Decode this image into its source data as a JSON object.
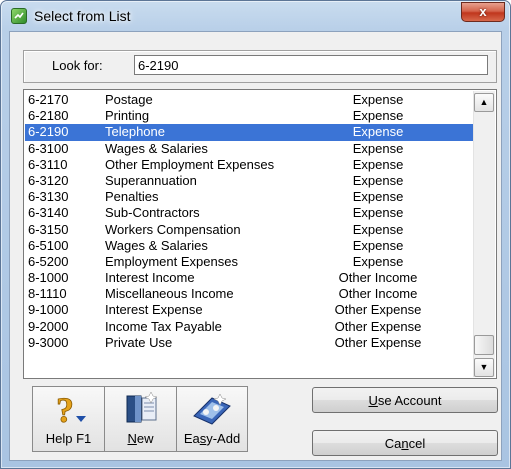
{
  "window": {
    "title": "Select from List",
    "close_glyph": "x"
  },
  "search": {
    "label": "Look for:",
    "value": "6-2190"
  },
  "accounts": [
    {
      "code": "6-2170",
      "name": "Postage",
      "type": "Expense"
    },
    {
      "code": "6-2180",
      "name": "Printing",
      "type": "Expense"
    },
    {
      "code": "6-2190",
      "name": "Telephone",
      "type": "Expense",
      "selected": true
    },
    {
      "code": "6-3100",
      "name": "Wages & Salaries",
      "type": "Expense"
    },
    {
      "code": "6-3110",
      "name": "Other Employment Expenses",
      "type": "Expense"
    },
    {
      "code": "6-3120",
      "name": "Superannuation",
      "type": "Expense"
    },
    {
      "code": "6-3130",
      "name": "Penalties",
      "type": "Expense"
    },
    {
      "code": "6-3140",
      "name": "Sub-Contractors",
      "type": "Expense"
    },
    {
      "code": "6-3150",
      "name": "Workers Compensation",
      "type": "Expense"
    },
    {
      "code": "6-5100",
      "name": "Wages & Salaries",
      "type": "Expense"
    },
    {
      "code": "6-5200",
      "name": "Employment Expenses",
      "type": "Expense"
    },
    {
      "code": "8-1000",
      "name": "Interest Income",
      "type": "Other Income"
    },
    {
      "code": "8-1110",
      "name": "Miscellaneous Income",
      "type": "Other Income"
    },
    {
      "code": "9-1000",
      "name": "Interest Expense",
      "type": "Other Expense"
    },
    {
      "code": "9-2000",
      "name": "Income Tax Payable",
      "type": "Other Expense"
    },
    {
      "code": "9-3000",
      "name": "Private Use",
      "type": "Other Expense"
    }
  ],
  "toolbar": {
    "help_label": "Help F1",
    "new_label_mnemonic": "N",
    "new_label_rest": "ew",
    "easyadd_label_pre": "Ea",
    "easyadd_label_mnemonic": "s",
    "easyadd_label_post": "y-Add",
    "help_icon": "help-question-icon",
    "new_icon": "new-ledger-icon",
    "easyadd_icon": "easy-add-icon"
  },
  "actions": {
    "use_mnemonic": "U",
    "use_rest": "se Account",
    "cancel_pre": "Ca",
    "cancel_mnemonic": "n",
    "cancel_post": "cel"
  },
  "colors": {
    "selection": "#3b74d6",
    "close_button": "#c0361d"
  }
}
